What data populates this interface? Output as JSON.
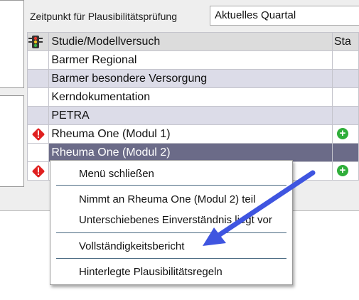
{
  "header": {
    "zeitpunkt_label": "Zeitpunkt für Plausibilitätsprüfung",
    "zeitpunkt_value": "Aktuelles Quartal"
  },
  "table": {
    "columns": {
      "icon": "traffic-light-icon",
      "name": "Studie/Modellversuch",
      "status": "Sta"
    },
    "rows": [
      {
        "name": "Barmer Regional",
        "icon": "",
        "status": ""
      },
      {
        "name": "Barmer besondere Versorgung",
        "icon": "",
        "status": ""
      },
      {
        "name": "Kerndokumentation",
        "icon": "",
        "status": ""
      },
      {
        "name": "PETRA",
        "icon": "",
        "status": ""
      },
      {
        "name": "Rheuma One (Modul 1)",
        "icon": "warning-icon",
        "status": "plus-icon"
      },
      {
        "name": "Rheuma One (Modul 2)",
        "icon": "",
        "status": "",
        "selected": true
      },
      {
        "name": "",
        "icon": "warning-icon",
        "status": "plus-icon"
      }
    ]
  },
  "context_menu": {
    "items": [
      "Menü schließen",
      "Nimmt an Rheuma One (Modul 2) teil",
      "Unterschiebenes Einverständnis liegt vor",
      "Vollständigkeitsbericht",
      "Hinterlegte Plausibilitätsregeln"
    ]
  },
  "colors": {
    "selected_row": "#6b6b88",
    "alt_row": "#dcdce8",
    "arrow": "#3f55e0",
    "warning": "#e02020",
    "plus": "#2fae3a"
  }
}
